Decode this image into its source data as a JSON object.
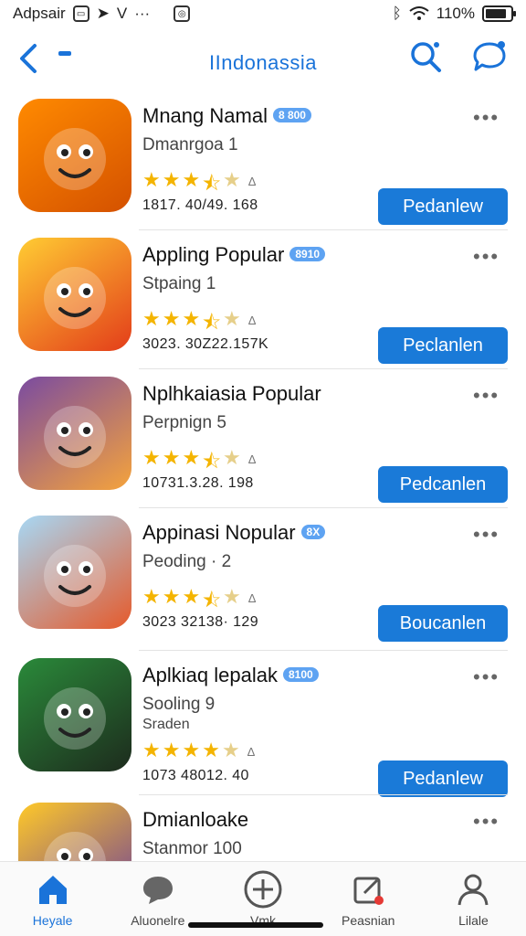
{
  "status_bar": {
    "left_text": "Adpsair",
    "left_extra": "V",
    "left_dots": "···",
    "battery_text": "110%",
    "battery_level": 0.8
  },
  "nav": {
    "title": "IIndonassia",
    "back_icon": "chevron-left-icon",
    "search_icon": "search-icon",
    "chat_icon": "chat-icon"
  },
  "apps": [
    {
      "name": "Mnang Namal",
      "badge": "8 800",
      "sub": "Dmanrgoa 1",
      "sub2": "",
      "rating": 3.5,
      "meta": "1817. 40/49. 168",
      "button": "Pedanlew",
      "colors": [
        "#ff8a00",
        "#d45100"
      ]
    },
    {
      "name": "Appling Popular",
      "badge": "8910",
      "sub": "Stpaing  1",
      "sub2": "",
      "rating": 3.5,
      "meta": "3023. 30Z22.157K",
      "button": "Peclanlen",
      "colors": [
        "#ffcc33",
        "#e33d1a"
      ]
    },
    {
      "name": "Nplhkaiasia Popular",
      "badge": "",
      "sub": "Perpnign 5",
      "sub2": "",
      "rating": 3.5,
      "meta": "10731.3.28. 198",
      "button": "Pedcanlen",
      "colors": [
        "#7a4ba0",
        "#f5a33c"
      ]
    },
    {
      "name": "Appinasi Nopular",
      "badge": "8X",
      "sub": "Peoding · 2",
      "sub2": "",
      "rating": 3.5,
      "meta": "3023 32138· 129",
      "button": "Boucanlen",
      "colors": [
        "#a7d8f5",
        "#e55a2b"
      ]
    },
    {
      "name": "Aplkiaq lepalak",
      "badge": "8100",
      "sub": "Sooling  9",
      "sub2": "Sraden",
      "rating": 4.0,
      "meta": "1073 48012. 40",
      "button": "Pedanlew",
      "colors": [
        "#2a8a3a",
        "#1d2b1d"
      ]
    },
    {
      "name": "Dmianloake",
      "badge": "",
      "sub": "Stanmor 100",
      "sub2": "",
      "rating": 0,
      "meta": "",
      "button": "",
      "colors": [
        "#ffc928",
        "#6a3c9b"
      ]
    }
  ],
  "tabs": [
    {
      "label": "Heyale",
      "icon": "home-icon",
      "active": true
    },
    {
      "label": "Aluonelre",
      "icon": "chat-bubble-icon",
      "active": false
    },
    {
      "label": "Vmk",
      "icon": "plus-circle-icon",
      "active": false
    },
    {
      "label": "Peasnian",
      "icon": "edit-notification-icon",
      "active": false
    },
    {
      "label": "Lilale",
      "icon": "profile-icon",
      "active": false
    }
  ]
}
